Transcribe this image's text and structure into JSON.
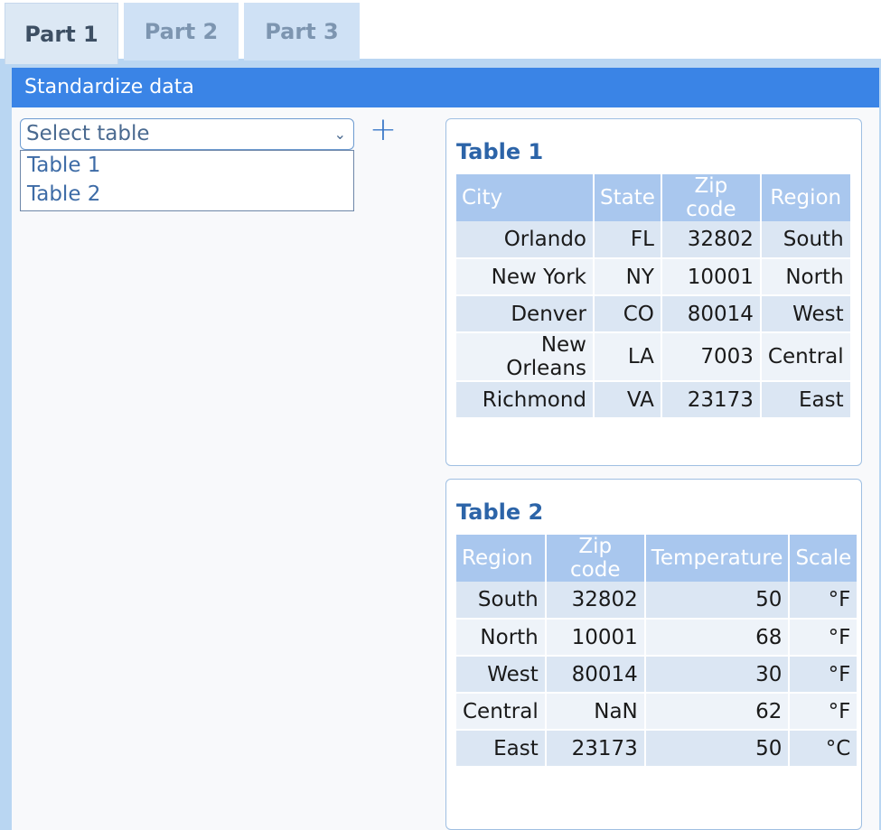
{
  "tabs": [
    {
      "label": "Part 1",
      "active": true
    },
    {
      "label": "Part 2",
      "active": false
    },
    {
      "label": "Part 3",
      "active": false
    }
  ],
  "panel": {
    "header": "Standardize data"
  },
  "select": {
    "placeholder": "Select table",
    "options": [
      "Table 1",
      "Table 2"
    ],
    "add_icon": "plus-icon",
    "chevron_icon": "chevron-down-icon"
  },
  "table1": {
    "title": "Table 1",
    "columns": [
      "City",
      "State",
      "Zip code",
      "Region"
    ],
    "rows": [
      [
        "Orlando",
        "FL",
        "32802",
        "South"
      ],
      [
        "New York",
        "NY",
        "10001",
        "North"
      ],
      [
        "Denver",
        "CO",
        "80014",
        "West"
      ],
      [
        "New Orleans",
        "LA",
        "7003",
        "Central"
      ],
      [
        "Richmond",
        "VA",
        "23173",
        "East"
      ]
    ]
  },
  "table2": {
    "title": "Table 2",
    "columns": [
      "Region",
      "Zip code",
      "Temperature",
      "Scale"
    ],
    "rows": [
      [
        "South",
        "32802",
        "50",
        "°F"
      ],
      [
        "North",
        "10001",
        "68",
        "°F"
      ],
      [
        "West",
        "80014",
        "30",
        "°F"
      ],
      [
        "Central",
        "NaN",
        "62",
        "°F"
      ],
      [
        "East",
        "23173",
        "50",
        "°C"
      ]
    ]
  },
  "colors": {
    "header_bar": "#3a84e6",
    "table_header": "#a9c7ee",
    "title_text": "#2c64a8"
  }
}
